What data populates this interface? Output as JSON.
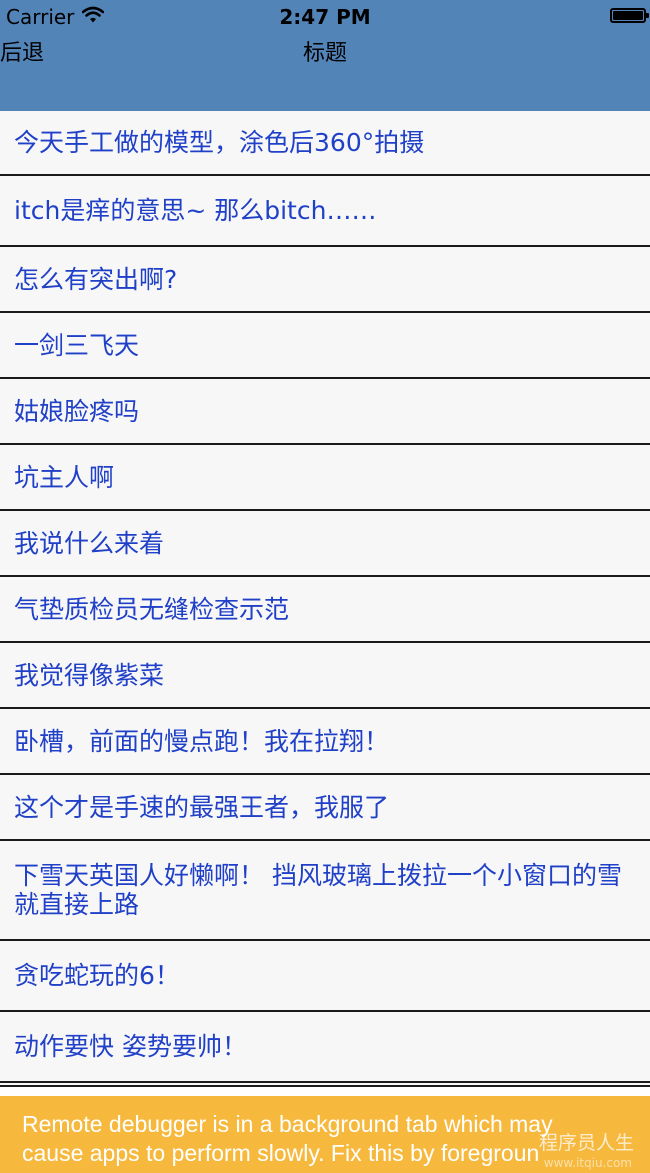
{
  "status_bar": {
    "carrier": "Carrier",
    "time": "2:47 PM"
  },
  "nav": {
    "back_label": "后退",
    "title": "标题"
  },
  "list": {
    "items": [
      {
        "label": "今天手工做的模型，涂色后360°拍摄"
      },
      {
        "label": "itch是痒的意思~ 那么bitch……"
      },
      {
        "label": "怎么有突出啊?"
      },
      {
        "label": "一剑三飞天"
      },
      {
        "label": "姑娘脸疼吗"
      },
      {
        "label": "坑主人啊"
      },
      {
        "label": "我说什么来着"
      },
      {
        "label": "气垫质检员无缝检查示范"
      },
      {
        "label": "我觉得像紫菜"
      },
      {
        "label": "卧槽，前面的慢点跑！我在拉翔！"
      },
      {
        "label": "这个才是手速的最强王者，我服了"
      },
      {
        "label": "下雪天英国人好懒啊！ 挡风玻璃上拨拉一个小窗口的雪就直接上路"
      },
      {
        "label": "贪吃蛇玩的6！"
      },
      {
        "label": "动作要快 姿势要帅！"
      }
    ]
  },
  "banner": {
    "line1": "Remote debugger is in a background tab which may",
    "line2": "cause apps to perform slowly. Fix this by foregroun",
    "watermark": "程序员人生",
    "watermark_sub": "www.itqiu.com"
  },
  "colors": {
    "nav_background": "#5384b8",
    "row_text": "#2040c8",
    "row_background": "#f7f7f7",
    "banner_background": "#f6b93e"
  },
  "icons": {
    "wifi": "wifi-icon",
    "battery": "battery-icon"
  }
}
